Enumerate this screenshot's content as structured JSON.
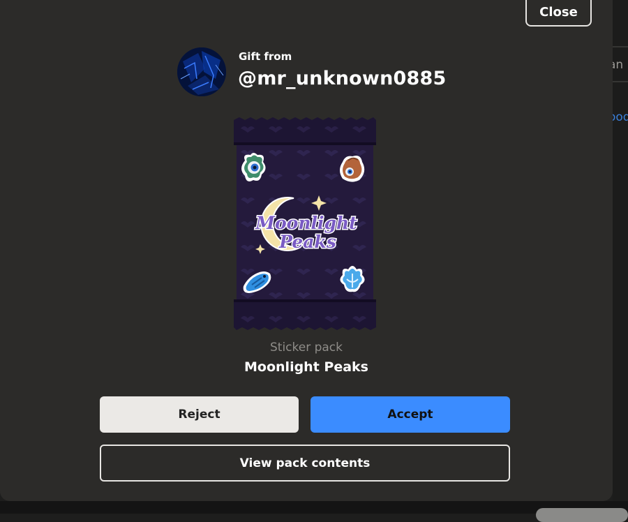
{
  "background": {
    "text_top": "an",
    "text_link": "ood"
  },
  "dialog": {
    "close_label": "Close",
    "gift_from_label": "Gift from",
    "username": "@mr_unknown0885",
    "pack_type": "Sticker pack",
    "pack_name": "Moonlight Peaks",
    "pack_art_text_line1": "Moonlight",
    "pack_art_text_line2": "Peaks",
    "reject_label": "Reject",
    "accept_label": "Accept",
    "view_contents_label": "View pack contents"
  },
  "colors": {
    "accent": "#3b8cff",
    "modal_bg": "#2c2b29",
    "pack_purple": "#241a3c"
  }
}
